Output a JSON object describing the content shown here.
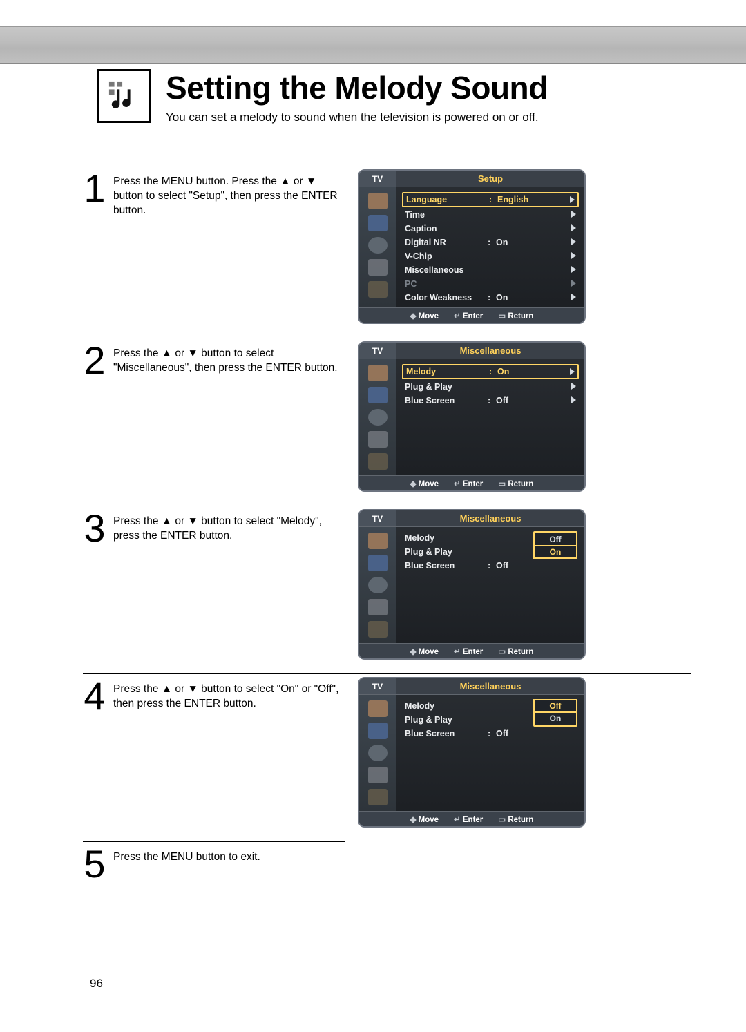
{
  "header": {
    "title": "Setting the Melody Sound",
    "subtitle": "You can set a melody to sound when the television is powered on or off."
  },
  "steps": [
    {
      "num": "1",
      "text": "Press the MENU button. Press the ▲ or ▼ button to select \"Setup\", then press the ENTER button."
    },
    {
      "num": "2",
      "text": "Press the ▲ or ▼ button to select \"Miscellaneous\", then press the ENTER button."
    },
    {
      "num": "3",
      "text": "Press the ▲ or ▼ button to select \"Melody\", press the ENTER button."
    },
    {
      "num": "4",
      "text": "Press the ▲ or ▼ button to select \"On\" or \"Off\", then press the ENTER button."
    },
    {
      "num": "5",
      "text": "Press the MENU button to exit."
    }
  ],
  "osd_labels": {
    "tv": "TV",
    "move": "Move",
    "enter": "Enter",
    "return": "Return"
  },
  "osd_panels": {
    "setup": {
      "title": "Setup",
      "rows": [
        {
          "label": "Language",
          "val": "English",
          "selected": true
        },
        {
          "label": "Time",
          "val": ""
        },
        {
          "label": "Caption",
          "val": ""
        },
        {
          "label": "Digital NR",
          "val": "On"
        },
        {
          "label": "V-Chip",
          "val": ""
        },
        {
          "label": "Miscellaneous",
          "val": ""
        },
        {
          "label": "PC",
          "val": "",
          "dim": true
        },
        {
          "label": "Color Weakness",
          "val": "On"
        }
      ]
    },
    "misc1": {
      "title": "Miscellaneous",
      "rows": [
        {
          "label": "Melody",
          "val": "On",
          "selected": true
        },
        {
          "label": "Plug & Play",
          "val": ""
        },
        {
          "label": "Blue Screen",
          "val": "Off"
        }
      ]
    },
    "misc2": {
      "title": "Miscellaneous",
      "rows": [
        {
          "label": "Melody",
          "val": ""
        },
        {
          "label": "Plug & Play",
          "val": ""
        },
        {
          "label": "Blue Screen",
          "val": "Off",
          "strike": true
        }
      ],
      "dropdown": {
        "options": [
          "Off",
          "On"
        ],
        "selected": "On"
      }
    },
    "misc3": {
      "title": "Miscellaneous",
      "rows": [
        {
          "label": "Melody",
          "val": ""
        },
        {
          "label": "Plug & Play",
          "val": ""
        },
        {
          "label": "Blue Screen",
          "val": "Off",
          "strike": true
        }
      ],
      "dropdown": {
        "options": [
          "Off",
          "On"
        ],
        "selected": "Off"
      }
    }
  },
  "page_number": "96"
}
